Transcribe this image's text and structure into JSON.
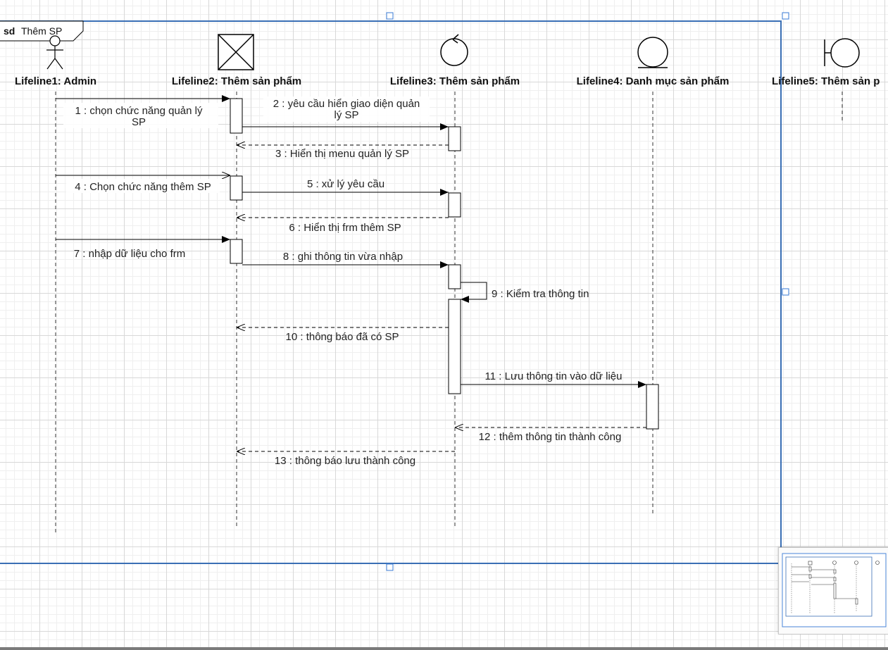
{
  "frame": {
    "keyword": "sd",
    "name": "Thêm SP"
  },
  "lifelines": [
    {
      "id": "l1",
      "label": "Lifeline1: Admin",
      "kind": "actor"
    },
    {
      "id": "l2",
      "label": "Lifeline2: Thêm sản phẩm",
      "kind": "boundary-box"
    },
    {
      "id": "l3",
      "label": "Lifeline3: Thêm sản phẩm",
      "kind": "control"
    },
    {
      "id": "l4",
      "label": "Lifeline4: Danh mục sản phẩm",
      "kind": "entity"
    },
    {
      "id": "l5",
      "label": "Lifeline5: Thêm sản p",
      "kind": "boundary"
    }
  ],
  "messages": [
    {
      "n": 1,
      "from": "l1",
      "to": "l2",
      "style": "sync",
      "lines": [
        "1 : chọn chức năng quản lý",
        "SP"
      ]
    },
    {
      "n": 2,
      "from": "l2",
      "to": "l3",
      "style": "sync",
      "lines": [
        "2 : yêu cầu hiển giao diện quản",
        "lý SP"
      ]
    },
    {
      "n": 3,
      "from": "l3",
      "to": "l2",
      "style": "reply",
      "lines": [
        "3 : Hiển thị menu quản lý SP"
      ]
    },
    {
      "n": 4,
      "from": "l1",
      "to": "l2",
      "style": "async",
      "lines": [
        "4 : Chọn chức năng thêm SP"
      ]
    },
    {
      "n": 5,
      "from": "l2",
      "to": "l3",
      "style": "sync",
      "lines": [
        "5 : xử lý yêu cầu"
      ]
    },
    {
      "n": 6,
      "from": "l3",
      "to": "l2",
      "style": "reply",
      "lines": [
        "6 : Hiển thị frm thêm SP"
      ]
    },
    {
      "n": 7,
      "from": "l1",
      "to": "l2",
      "style": "sync",
      "lines": [
        "7 : nhập dữ liệu cho frm"
      ]
    },
    {
      "n": 8,
      "from": "l2",
      "to": "l3",
      "style": "sync",
      "lines": [
        "8 : ghi thông tin vừa nhập"
      ]
    },
    {
      "n": 9,
      "from": "l3",
      "to": "l3",
      "style": "self",
      "lines": [
        "9 : Kiểm tra thông tin"
      ]
    },
    {
      "n": 10,
      "from": "l3",
      "to": "l2",
      "style": "reply",
      "lines": [
        "10 : thông báo đã có SP"
      ]
    },
    {
      "n": 11,
      "from": "l3",
      "to": "l4",
      "style": "sync",
      "lines": [
        "11 : Lưu thông tin vào dữ liệu"
      ]
    },
    {
      "n": 12,
      "from": "l4",
      "to": "l3",
      "style": "reply",
      "lines": [
        "12 : thêm thông tin thành công"
      ]
    },
    {
      "n": 13,
      "from": "l3",
      "to": "l2",
      "style": "reply",
      "lines": [
        "13 : thông báo lưu thành công"
      ]
    }
  ],
  "colors": {
    "frame_border": "#3a6fb5",
    "selection_handle": "#3a7bd5",
    "line": "#000000",
    "lifeline_dash": "#333333"
  }
}
